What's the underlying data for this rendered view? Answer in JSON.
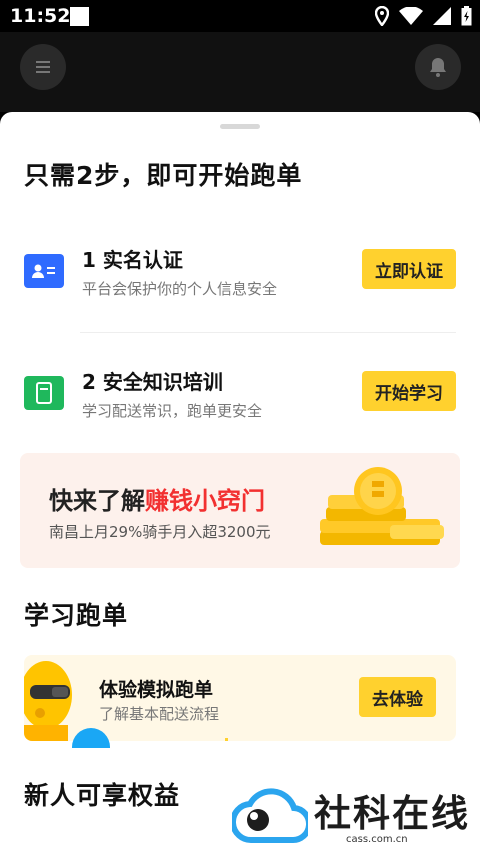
{
  "status_bar": {
    "time": "11:52"
  },
  "sheet": {
    "heading": "只需2步，即可开始跑单",
    "steps": [
      {
        "title": "1 实名认证",
        "desc": "平台会保护你的个人信息安全",
        "button": "立即认证",
        "icon": "id-card-icon"
      },
      {
        "title": "2 安全知识培训",
        "desc": "学习配送常识，跑单更安全",
        "button": "开始学习",
        "icon": "book-icon"
      }
    ],
    "banner": {
      "title_plain": "快来了解",
      "title_highlight": "赚钱小窍门",
      "subtitle": "南昌上月29%骑手月入超3200元"
    },
    "learn_heading": "学习跑单",
    "practice": {
      "title": "体验模拟跑单",
      "desc": "了解基本配送流程",
      "button": "去体验"
    },
    "benefits_heading": "新人可享权益"
  },
  "watermark": {
    "name": "社科在线",
    "url": "cass.com.cn"
  },
  "colors": {
    "accent": "#ffd12e",
    "highlight_red": "#f23030",
    "blue_icon": "#2f6bff",
    "green_icon": "#1fb85c"
  }
}
